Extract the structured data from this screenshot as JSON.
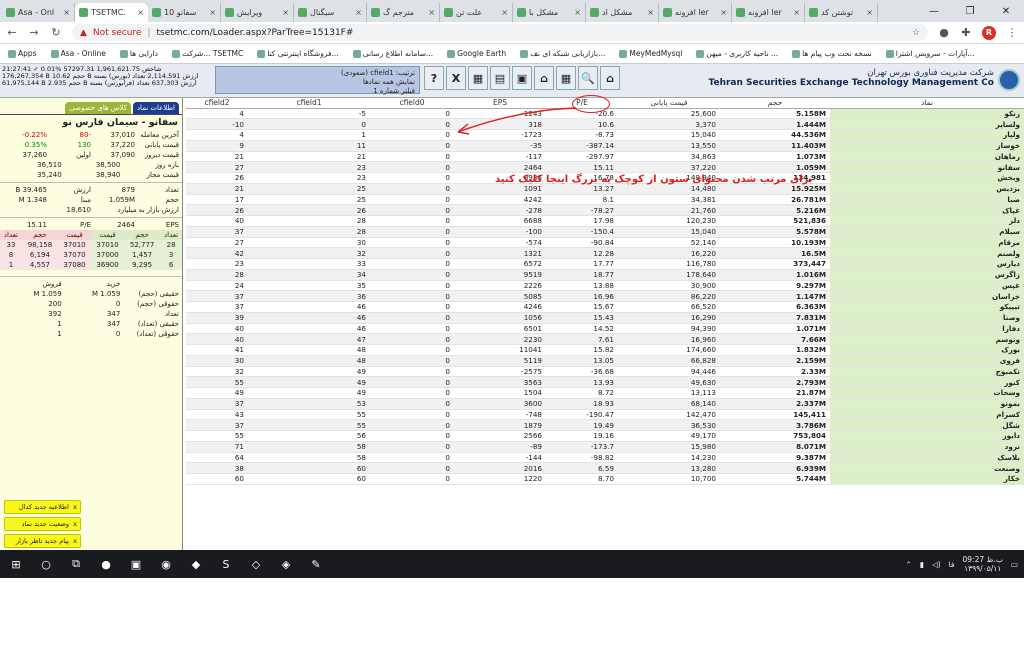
{
  "browser": {
    "tabs": [
      "Asa - Onl",
      "TSETMC.",
      "سفانو 10",
      "ویرایش",
      "سیگنال",
      "مترجم گ",
      "علت تن",
      "مشکل با",
      "مشکل اد",
      "افزونه ler",
      "افزونه ler",
      "توشتن کد"
    ],
    "active_tab_index": 1,
    "window_controls": [
      "—",
      "❐",
      "✕"
    ],
    "security_label": "Not secure",
    "url": "tsetmc.com/Loader.aspx?ParTree=15131F#",
    "avatar_letter": "R",
    "bookmarks": [
      "Apps",
      "Asa - Online",
      "دارایی ها",
      "شرکت... TSETMC",
      "فروشگاه اینترنتی کتا...",
      "سامانه اطلاع رسانی...",
      "Google Earth",
      "بازاریابی شبکه ای نف...",
      "MeyMedMysql",
      "ناحیه کاربری - میهن ...",
      "نسخه تحت وب پیام ها",
      "آپارات - سرویس اشترا..."
    ]
  },
  "site": {
    "title_fa": "شرکت مدیریت فناوری بورس تهران",
    "title_en": "Tehran Securities Exchange Technology Management Co",
    "index_lines": [
      "21:27:41 ✓ 0.01% 57297.31 شاخص 1,961,621.75",
      "176,267,354 B حجم 10.62 B ارزش 2,114,591 تعداد (بورس) بسته",
      "61,975,144 B حجم 2.935 B ارزش 637,303 تعداد (فرابورس) بسته"
    ],
    "filter_lines": [
      "ترتیب: cfield1 (صعودی)",
      "نمایش همه نمادها",
      "فیلتر شماره 1"
    ],
    "toolbar_icons": [
      "?",
      "X",
      "▦",
      "▤",
      "▣",
      "⌂",
      "▦",
      "🔍",
      "⌂"
    ]
  },
  "left_panel": {
    "tabs": [
      "اطلاعات نماد",
      "کلاس های خصوصی"
    ],
    "symbol_name": "سفانو - سیمان فارس نو",
    "price_rows": [
      {
        "label": "آخرین معامله",
        "value": "37,010",
        "change": "-80",
        "pct": "0.22%-"
      },
      {
        "label": "قیمت پایانی",
        "value": "37,220",
        "change": "130",
        "pct": "0.35%"
      },
      {
        "label": "قیمت دیروز",
        "value": "37,090",
        "label2": "اولین",
        "value2": "37,260"
      },
      {
        "label": "بازه روز",
        "value": "38,500",
        "value2": "36,510"
      },
      {
        "label": "قیمت مجاز",
        "value": "38,940",
        "value2": "35,240"
      }
    ],
    "stats_rows": [
      {
        "label": "تعداد",
        "value": "879",
        "label2": "ارزش",
        "value2": "39.465 B"
      },
      {
        "label": "حجم",
        "value": "1.059M",
        "label2": "مبنا",
        "value2": "1.348 M"
      },
      {
        "label": "ارزش بازار به میلیارد",
        "value": "18,610"
      }
    ],
    "eps": {
      "label": "EPS",
      "value": "2464",
      "pe_label": "P/E",
      "pe": "15.11"
    },
    "order_headers": [
      "تعداد",
      "حجم",
      "قیمت",
      "قیمت",
      "حجم",
      "تعداد"
    ],
    "orders": [
      [
        "28",
        "52,777",
        "37010",
        "37010",
        "98,158",
        "33"
      ],
      [
        "3",
        "1,457",
        "37000",
        "37070",
        "6,194",
        "8"
      ],
      [
        "6",
        "9,295",
        "36900",
        "37080",
        "4,557",
        "1"
      ]
    ],
    "trade_headers": [
      "خرید",
      "فروش"
    ],
    "trade_rows": [
      {
        "label": "حقیقی (حجم)",
        "buy": "1.059 M",
        "sell": "1.059 M"
      },
      {
        "label": "حقوقی (حجم)",
        "buy": "0",
        "sell": "200"
      },
      {
        "label": "تعداد",
        "buy": "347",
        "sell": "392"
      },
      {
        "label": "حقیقی (تعداد)",
        "buy": "347",
        "sell": "1"
      },
      {
        "label": "حقوقی (تعداد)",
        "buy": "0",
        "sell": "1"
      }
    ],
    "notifications": [
      "اطلاعیه جدید کدال",
      "وضعیت جدید نماد",
      "پیام جدید ناظر بازار"
    ]
  },
  "grid": {
    "columns": [
      "cfield2",
      "cfield1",
      "cfield0",
      "EPS",
      "P/E",
      "قیمت پایانی",
      "حجم",
      "نماد"
    ],
    "rows": [
      [
        "4",
        "-5",
        "0",
        "-1243",
        "-20.6",
        "25,600",
        "5.158M",
        "رنکو"
      ],
      [
        "-10",
        "0",
        "0",
        "318",
        "10.6",
        "3,370",
        "1.444M",
        "ولساپر"
      ],
      [
        "4",
        "1",
        "0",
        "-1723",
        "-8.73",
        "15,040",
        "44.536M",
        "ولپار"
      ],
      [
        "9",
        "11",
        "0",
        "-35",
        "-387.14",
        "13,550",
        "11.403M",
        "خوساز"
      ],
      [
        "21",
        "21",
        "0",
        "-117",
        "-297.97",
        "34,863",
        "1.073M",
        "رماهان"
      ],
      [
        "27",
        "23",
        "0",
        "2464",
        "15.11",
        "37,220",
        "1.059M",
        "سفانو"
      ],
      [
        "26",
        "23",
        "0",
        "8936",
        "16.78",
        "149,940",
        "134,981",
        "وبخش"
      ],
      [
        "21",
        "25",
        "0",
        "1091",
        "13.27",
        "14,480",
        "15.925M",
        "بزدیس"
      ],
      [
        "17",
        "25",
        "0",
        "4242",
        "8.1",
        "34,381",
        "26.781M",
        "ضبا"
      ],
      [
        "26",
        "26",
        "0",
        "-278",
        "-78.27",
        "21,760",
        "5.216M",
        "غپاک"
      ],
      [
        "40",
        "28",
        "0",
        "6688",
        "17.98",
        "120,230",
        "521,836",
        "دلر"
      ],
      [
        "37",
        "28",
        "0",
        "-100",
        "-150.4",
        "15,040",
        "5.578M",
        "سبلام"
      ],
      [
        "27",
        "30",
        "0",
        "-574",
        "-90.84",
        "52,140",
        "10.193M",
        "مرقام"
      ],
      [
        "42",
        "32",
        "0",
        "1321",
        "12.28",
        "16,220",
        "16.5M",
        "ولصنم"
      ],
      [
        "23",
        "33",
        "0",
        "6572",
        "17.77",
        "116,780",
        "373,447",
        "دیارس"
      ],
      [
        "28",
        "34",
        "0",
        "9519",
        "18.77",
        "178,640",
        "1.016M",
        "زاگرس"
      ],
      [
        "24",
        "35",
        "0",
        "2226",
        "13.88",
        "30,900",
        "9.297M",
        "غپس"
      ],
      [
        "37",
        "36",
        "0",
        "5085",
        "16.96",
        "86,220",
        "1.147M",
        "خراسان"
      ],
      [
        "37",
        "46",
        "0",
        "4246",
        "15.67",
        "66,520",
        "6.363M",
        "تیپیکو"
      ],
      [
        "39",
        "46",
        "0",
        "1056",
        "15.43",
        "16,290",
        "7.831M",
        "وصنا"
      ],
      [
        "40",
        "46",
        "0",
        "6501",
        "14.52",
        "94,390",
        "1.071M",
        "دفارا"
      ],
      [
        "40",
        "47",
        "0",
        "2230",
        "7.61",
        "16,960",
        "7.66M",
        "ونوسم"
      ],
      [
        "41",
        "48",
        "0",
        "11041",
        "15.82",
        "174,660",
        "1.832M",
        "بورک"
      ],
      [
        "30",
        "48",
        "0",
        "5119",
        "13.05",
        "66,828",
        "2.159M",
        "فروی"
      ],
      [
        "32",
        "49",
        "0",
        "-2575",
        "-36.68",
        "94,446",
        "2.33M",
        "تکمبوج"
      ],
      [
        "55",
        "49",
        "0",
        "3563",
        "13.93",
        "49,630",
        "2.793M",
        "کنور"
      ],
      [
        "49",
        "49",
        "0",
        "1504",
        "8.72",
        "13,113",
        "21.87M",
        "وسحات"
      ],
      [
        "37",
        "53",
        "0",
        "3600",
        "18.93",
        "68,140",
        "2.337M",
        "بموتو"
      ],
      [
        "43",
        "55",
        "0",
        "-748",
        "-190.47",
        "142,470",
        "145,411",
        "کسرام"
      ],
      [
        "37",
        "55",
        "0",
        "1879",
        "19.49",
        "36,530",
        "3.786M",
        "شگل"
      ],
      [
        "55",
        "56",
        "0",
        "2566",
        "19.16",
        "49,170",
        "753,804",
        "دابور"
      ],
      [
        "71",
        "58",
        "0",
        "-89",
        "-173.7",
        "15,980",
        "8.071M",
        "نرود"
      ],
      [
        "64",
        "58",
        "0",
        "-144",
        "-98.82",
        "14,230",
        "9.387M",
        "بلاسک"
      ],
      [
        "38",
        "60",
        "0",
        "2016",
        "6.59",
        "13,280",
        "6.939M",
        "وصنعت"
      ],
      [
        "60",
        "60",
        "0",
        "1220",
        "8.70",
        "10,700",
        "5.744M",
        "خکار"
      ]
    ]
  },
  "annotation": "برای مرتب شدن محتوای ستون از کوچک به بزرگ  اینجا کلیک کنید",
  "taskbar": {
    "apps": [
      "⊞",
      "○",
      "⧉",
      "●",
      "▣",
      "◉",
      "◆",
      "S",
      "◇",
      "◈",
      "✎"
    ],
    "tray_lang": "فا",
    "time": "09:27 ب.ظ",
    "date": "۱۳۹۹/۰۵/۱۱"
  }
}
